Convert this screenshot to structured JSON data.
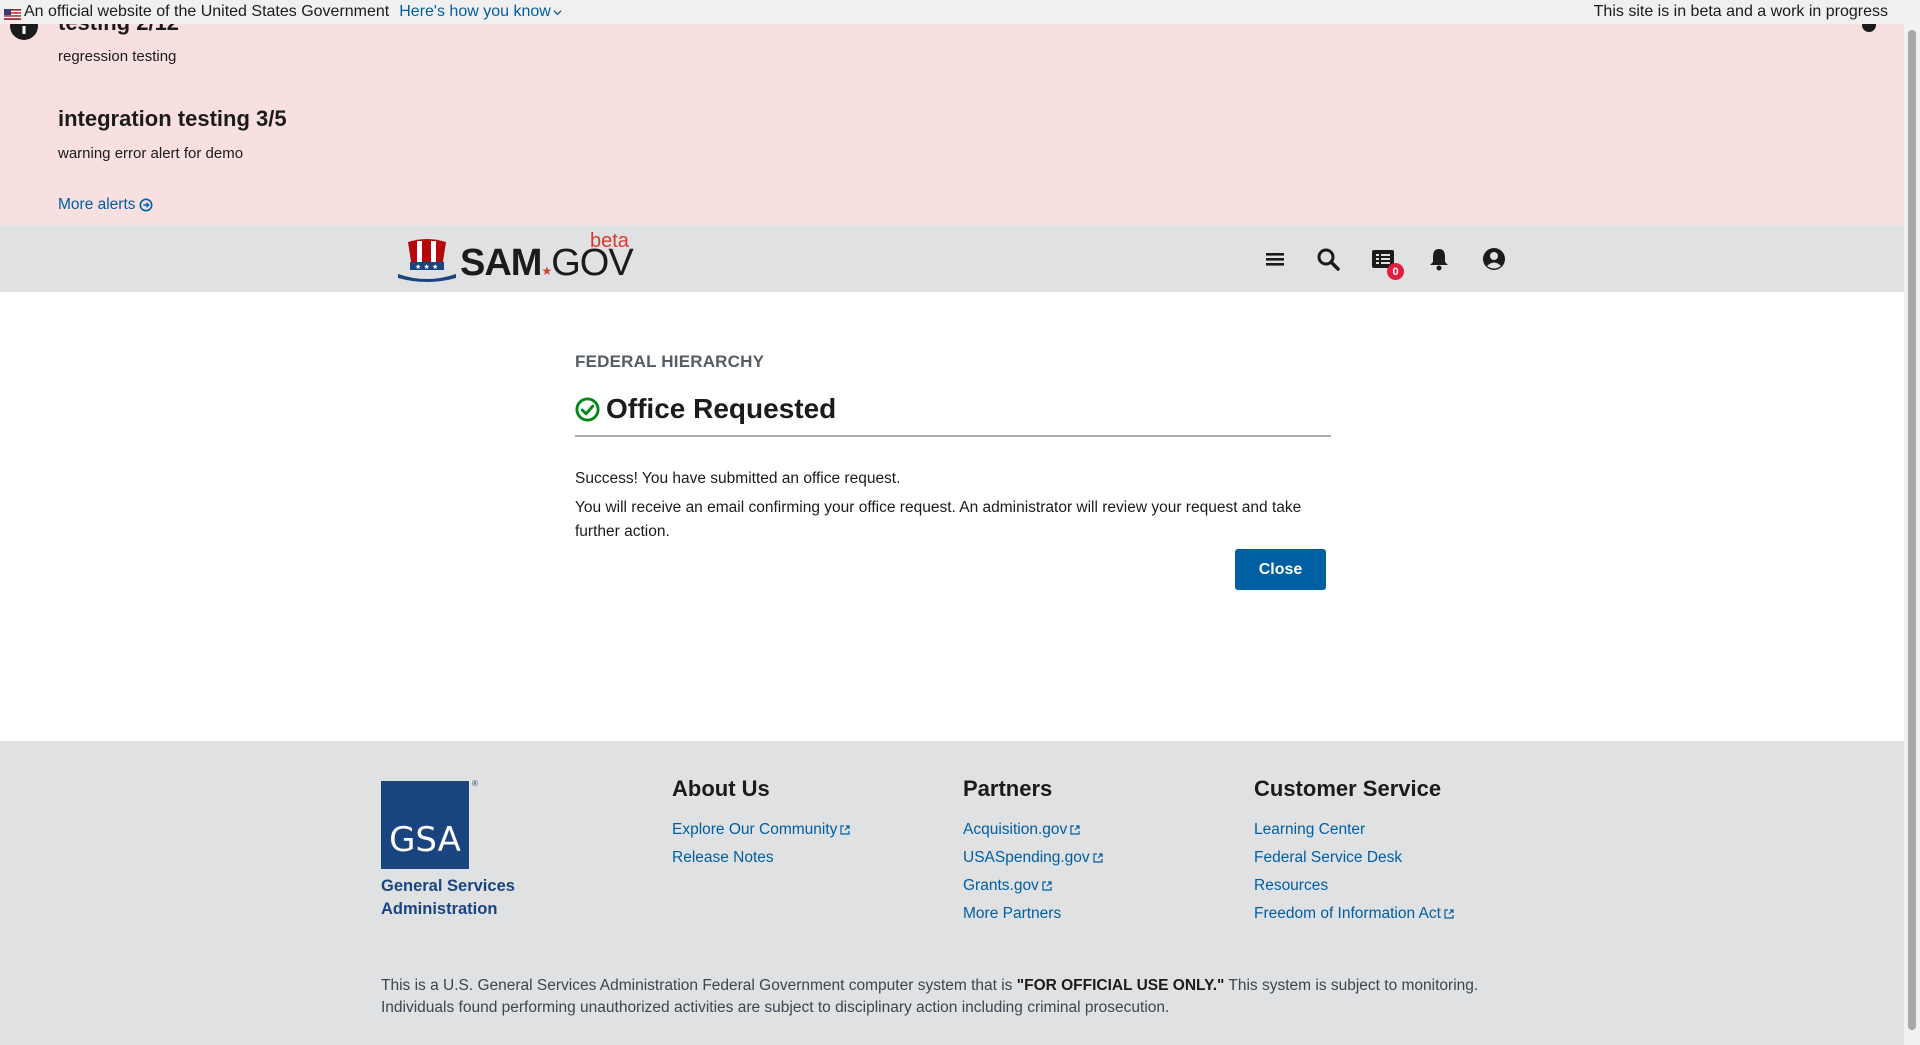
{
  "gov_banner": {
    "official_text": "An official website of the United States Government",
    "how_link": "Here's how you know",
    "beta_text": "This site is in beta and a work in progress"
  },
  "alerts": {
    "items": [
      {
        "title": "testing 2/12",
        "body": "regression testing"
      },
      {
        "title": "integration testing 3/5",
        "body": "warning error alert for demo"
      }
    ],
    "more_label": "More alerts"
  },
  "header": {
    "logo_text": "SAM",
    "logo_gov": "GOV",
    "logo_beta": "beta",
    "notification_count": "0",
    "icons": [
      "menu-icon",
      "search-icon",
      "messages-icon",
      "bell-icon",
      "user-icon"
    ]
  },
  "main": {
    "eyebrow": "FEDERAL HIERARCHY",
    "title": "Office Requested",
    "message1": "Success! You have submitted an office request.",
    "message2": "You will receive an email confirming your office request. An administrator will review your request and take further action.",
    "close_label": "Close"
  },
  "footer": {
    "gsa_logo_text": "GSA",
    "gsa_name_line1": "General Services",
    "gsa_name_line2": "Administration",
    "columns": [
      {
        "title": "About Us",
        "links": [
          {
            "label": "Explore Our Community",
            "external": true
          },
          {
            "label": "Release Notes",
            "external": false
          }
        ]
      },
      {
        "title": "Partners",
        "links": [
          {
            "label": "Acquisition.gov",
            "external": true
          },
          {
            "label": "USASpending.gov",
            "external": true
          },
          {
            "label": "Grants.gov",
            "external": true
          },
          {
            "label": "More Partners",
            "external": false
          }
        ]
      },
      {
        "title": "Customer Service",
        "links": [
          {
            "label": "Learning Center",
            "external": false
          },
          {
            "label": "Federal Service Desk",
            "external": false
          },
          {
            "label": "Resources",
            "external": false
          },
          {
            "label": "Freedom of Information Act",
            "external": true
          }
        ]
      }
    ],
    "disclaimer_prefix": "This is a U.S. General Services Administration Federal Government computer system that is ",
    "disclaimer_bold": "\"FOR OFFICIAL USE ONLY.\"",
    "disclaimer_suffix": " This system is subject to monitoring. Individuals found performing unauthorized activities are subject to disciplinary action including criminal prosecution."
  },
  "colors": {
    "alert_bg": "#f8dfe0",
    "header_bg": "#dfe1e2",
    "primary": "#005ea2",
    "success": "#00a91c",
    "gsa_blue": "#1a4480",
    "badge": "#e41d3d"
  }
}
